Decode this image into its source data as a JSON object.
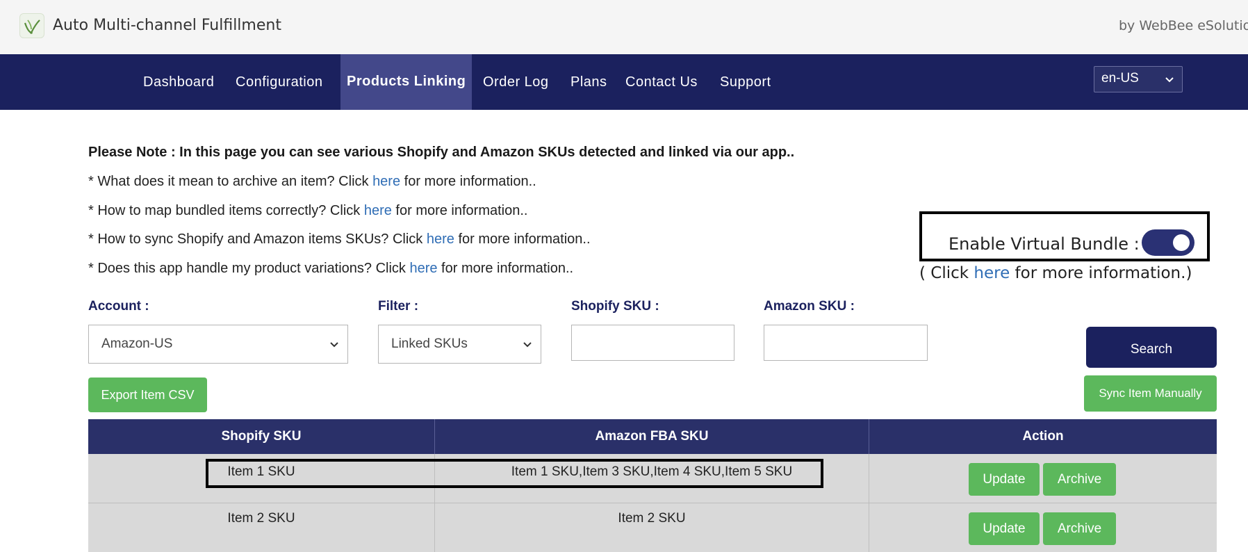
{
  "header": {
    "title": "Auto Multi-channel Fulfillment",
    "by": "by WebBee eSolution"
  },
  "nav": {
    "items": [
      "Dashboard",
      "Configuration",
      "Products Linking",
      "Order Log",
      "Plans",
      "Contact Us",
      "Support"
    ],
    "active": "Products Linking",
    "language": "en-US"
  },
  "notes": {
    "title": "Please Note : In this page you can see various Shopify and Amazon SKUs detected and linked via our app..",
    "lines": [
      {
        "pre": "* What does it mean to archive an item? Click ",
        "link": "here",
        "post": " for more information.."
      },
      {
        "pre": "* How to map bundled items correctly? Click ",
        "link": "here",
        "post": " for more information.."
      },
      {
        "pre": "* How to sync Shopify and Amazon items SKUs? Click ",
        "link": "here",
        "post": " for more information.."
      },
      {
        "pre": "* Does this app handle my product variations? Click ",
        "link": "here",
        "post": " for more information.."
      }
    ]
  },
  "virtual_bundle": {
    "label": "Enable Virtual Bundle :",
    "enabled": true,
    "help_pre": "( Click ",
    "help_link": "here",
    "help_post": " for more information.)"
  },
  "filters": {
    "account_label": "Account :",
    "account_value": "Amazon-US",
    "filter_label": "Filter :",
    "filter_value": "Linked SKUs",
    "shopify_sku_label": "Shopify SKU :",
    "shopify_sku_value": "",
    "amazon_sku_label": "Amazon SKU :",
    "amazon_sku_value": "",
    "search_button": "Search"
  },
  "actions": {
    "export_button": "Export Item CSV",
    "sync_button": "Sync Item Manually"
  },
  "table": {
    "columns": [
      "Shopify SKU",
      "Amazon FBA SKU",
      "Action"
    ],
    "rows": [
      {
        "shopify_sku": "Item 1 SKU",
        "amazon_sku": "Item 1 SKU,Item 3 SKU,Item 4 SKU,Item 5 SKU",
        "update": "Update",
        "archive": "Archive"
      },
      {
        "shopify_sku": "Item 2 SKU",
        "amazon_sku": "Item 2 SKU",
        "update": "Update",
        "archive": "Archive"
      }
    ]
  },
  "colors": {
    "navbar": "#1b215e",
    "nav_active": "#43488a",
    "link": "#2f6db5",
    "green_button": "#5cb85c",
    "table_header": "#2a3069",
    "table_row": "#d9d9d9"
  }
}
